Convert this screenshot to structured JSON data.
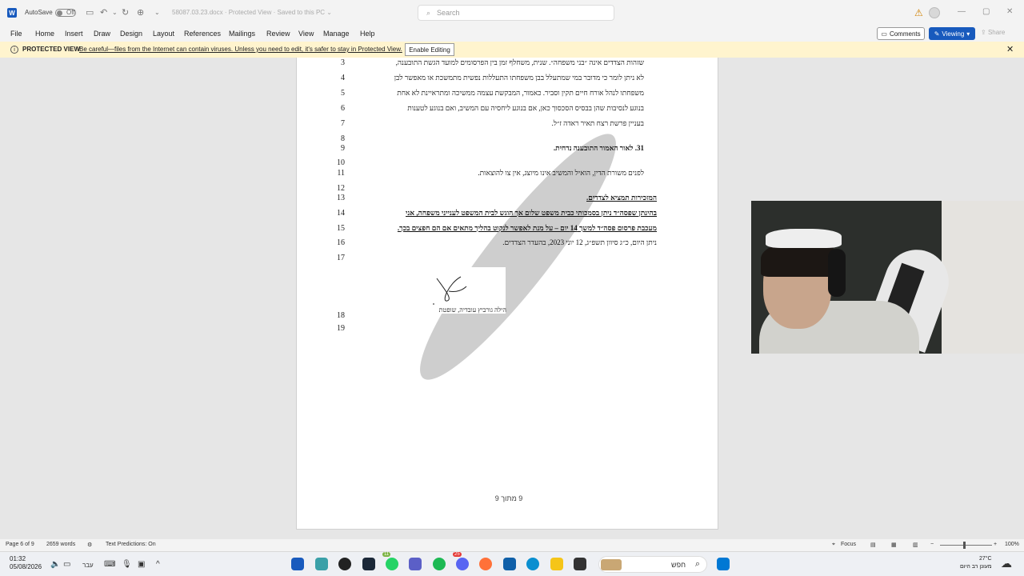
{
  "titlebar": {
    "app_letter": "W",
    "autosave_label": "AutoSave",
    "autosave_state": "Off",
    "doc_title": "58087.03.23.docx  ·  Protected View  ·  Saved to this PC  ⌄",
    "search_placeholder": "Search",
    "warning_icon": "⚠"
  },
  "menu": {
    "file": "File",
    "home": "Home",
    "insert": "Insert",
    "draw": "Draw",
    "design": "Design",
    "layout": "Layout",
    "references": "References",
    "mailings": "Mailings",
    "review": "Review",
    "view": "View",
    "manage": "Manage",
    "help": "Help",
    "comments": "Comments",
    "viewing": "Viewing",
    "share": "Share"
  },
  "protected_view": {
    "title": "PROTECTED VIEW",
    "message": "Be careful—files from the Internet can contain viruses. Unless you need to edit, it's safer to stay in Protected View.",
    "enable_button": "Enable Editing",
    "close": "✕"
  },
  "document": {
    "lines": [
      {
        "n": "3",
        "text": "שזהות הצדדים אינה ״בני משפחה״. שנית, משחלף זמן בין הפרסומים למועד הגשת התובענה,",
        "style": ""
      },
      {
        "n": "4",
        "text": "לא ניתן לומר כי מדובר במי שמתעלל בבן משפחתו התעללות נפשית מתמשכת או מאפשר לבן",
        "style": ""
      },
      {
        "n": "5",
        "text": "משפחתו לנהל אורח חיים תקין וסביר. כאמור, המבקשת עצמה ממשיכה ומתראיינת לא אחת",
        "style": ""
      },
      {
        "n": "6",
        "text": "בנוגע לנסיבות שהן בבסיס הסכסוך כאן, אם בנוגע ליחסיה עם המשיב, ואם בנוגע לטענות",
        "style": ""
      },
      {
        "n": "7",
        "text": "בעניין פרשת רצח תאיר ראדה ז״ל.",
        "style": ""
      },
      {
        "n": "8",
        "text": "",
        "style": ""
      },
      {
        "n": "9",
        "text": "31. לאור האמור התובענה נדחית.",
        "style": "b"
      },
      {
        "n": "10",
        "text": "",
        "style": ""
      },
      {
        "n": "11",
        "text": "לפנים משורת הדין, הואיל והמשיב אינו מיוצג, אין צו להוצאות.",
        "style": ""
      },
      {
        "n": "12",
        "text": "",
        "style": ""
      },
      {
        "n": "13",
        "text": "המזכירות תמציא לצדדים.",
        "style": "b u"
      },
      {
        "n": "14",
        "text": "בהינתן שפסה״ד ניתן בסמכותי כבית משפט שלום אך הוגש לבית המשפט לענייני משפחה, אני",
        "style": "b u"
      },
      {
        "n": "15",
        "text": "מעכבת פרסום פסה״ד למשך 14 יום – על מנת לאפשר לנקוט בהליך מתאים אם הם חפצים בכך.",
        "style": "b u"
      },
      {
        "n": "16",
        "text": "ניתן היום, כ״ג סיוון תשפ״ג, 12 יוני 2023, בהעדר הצדדים.",
        "style": ""
      },
      {
        "n": "17",
        "text": "",
        "style": ""
      },
      {
        "n": "18",
        "text": "",
        "style": ""
      },
      {
        "n": "19",
        "text": "",
        "style": ""
      }
    ],
    "signature_name": "הילה גורביץ עובדיה, שופטת",
    "page_footer": "9 מתוך 9"
  },
  "status": {
    "page": "Page 6 of 9",
    "words": "2659 words",
    "text_predictions": "Text Predictions: On",
    "focus": "Focus",
    "zoom": "100%"
  },
  "taskbar": {
    "time": "01:32",
    "date": "05/08/2026",
    "lang": "עבר",
    "search_text": "חפש",
    "weather_temp": "27°C",
    "weather_desc": "מעונן רב היום",
    "badge_whatsapp": "11",
    "badge_discord": "25"
  }
}
